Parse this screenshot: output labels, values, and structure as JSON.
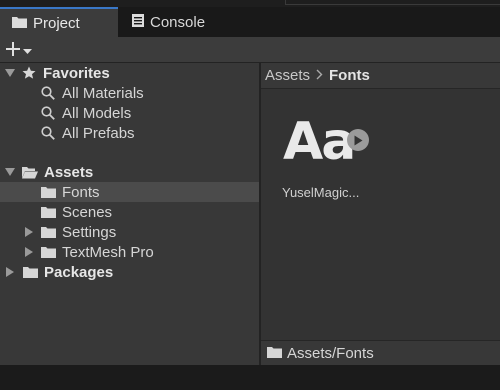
{
  "tabs": [
    {
      "label": "Project",
      "icon": "folder-icon",
      "active": true
    },
    {
      "label": "Console",
      "icon": "console-icon",
      "active": false
    }
  ],
  "toolbar": {
    "add_label": "+"
  },
  "tree": {
    "favorites": {
      "label": "Favorites",
      "items": [
        {
          "label": "All Materials",
          "icon": "search-icon"
        },
        {
          "label": "All Models",
          "icon": "search-icon"
        },
        {
          "label": "All Prefabs",
          "icon": "search-icon"
        }
      ]
    },
    "assets": {
      "label": "Assets",
      "items": [
        {
          "label": "Fonts",
          "selected": true
        },
        {
          "label": "Scenes"
        },
        {
          "label": "Settings"
        },
        {
          "label": "TextMesh Pro"
        }
      ]
    },
    "packages": {
      "label": "Packages"
    }
  },
  "breadcrumb": {
    "root": "Assets",
    "current": "Fonts"
  },
  "grid": {
    "items": [
      {
        "glyph": "Aa",
        "label": "YuselMagic..."
      }
    ]
  },
  "pathbar": {
    "path": "Assets/Fonts"
  },
  "colors": {
    "active_tab_accent": "#3a78c8",
    "panel_bg": "#383838",
    "selection_bg": "#4b4b4b"
  }
}
